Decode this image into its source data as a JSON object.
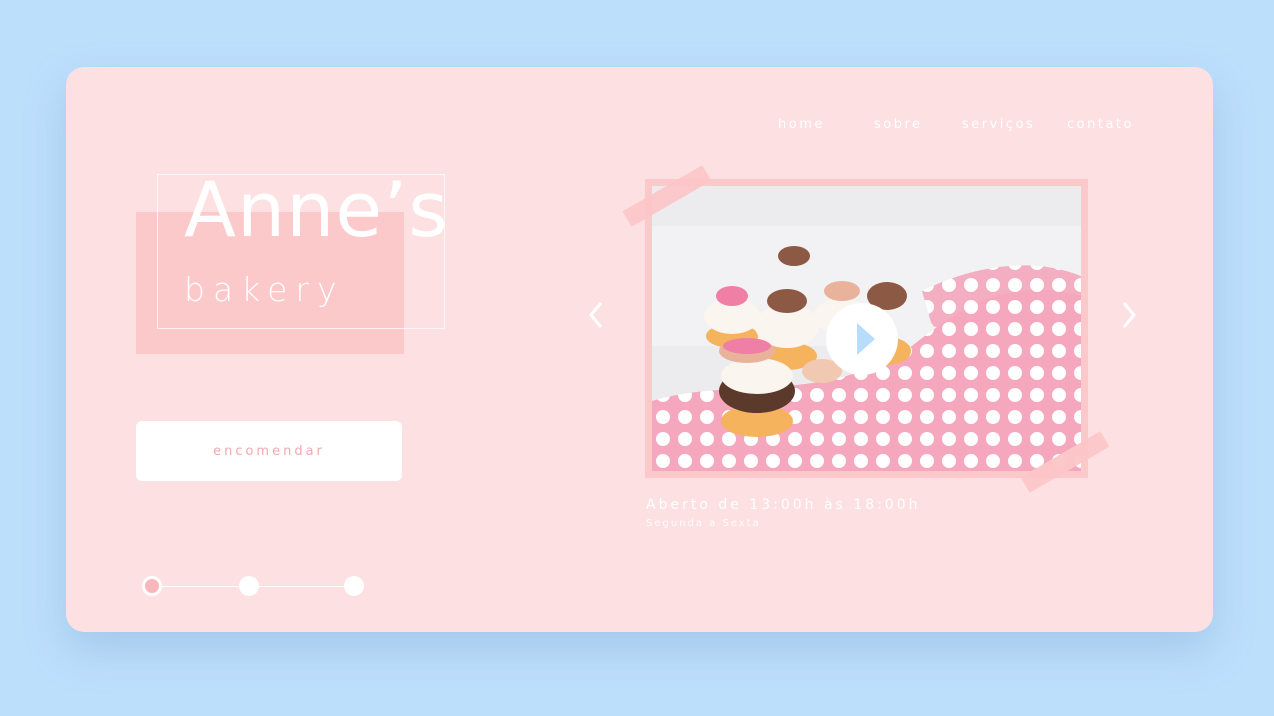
{
  "nav": {
    "items": [
      {
        "label": "home"
      },
      {
        "label": "sobre"
      },
      {
        "label": "serviços"
      },
      {
        "label": "contato"
      }
    ]
  },
  "logo": {
    "title": "Anne’s",
    "subtitle": "bakery"
  },
  "order_button": {
    "label": "encomendar"
  },
  "carousel": {
    "prev_icon": "chevron-left-icon",
    "next_icon": "chevron-right-icon",
    "play_icon": "play-icon",
    "image_alt_subject": "cupcakes and macarons on polka-dot cloth"
  },
  "hours": {
    "title": "Aberto de 13:00h às 18:00h",
    "days": "Segunda a Sexta"
  },
  "steps": {
    "count": 3,
    "active": 1
  },
  "colors": {
    "background": "#bcdffc",
    "card": "#fde0e1",
    "accent": "#fcc9cb",
    "play": "#b8dcfb"
  }
}
